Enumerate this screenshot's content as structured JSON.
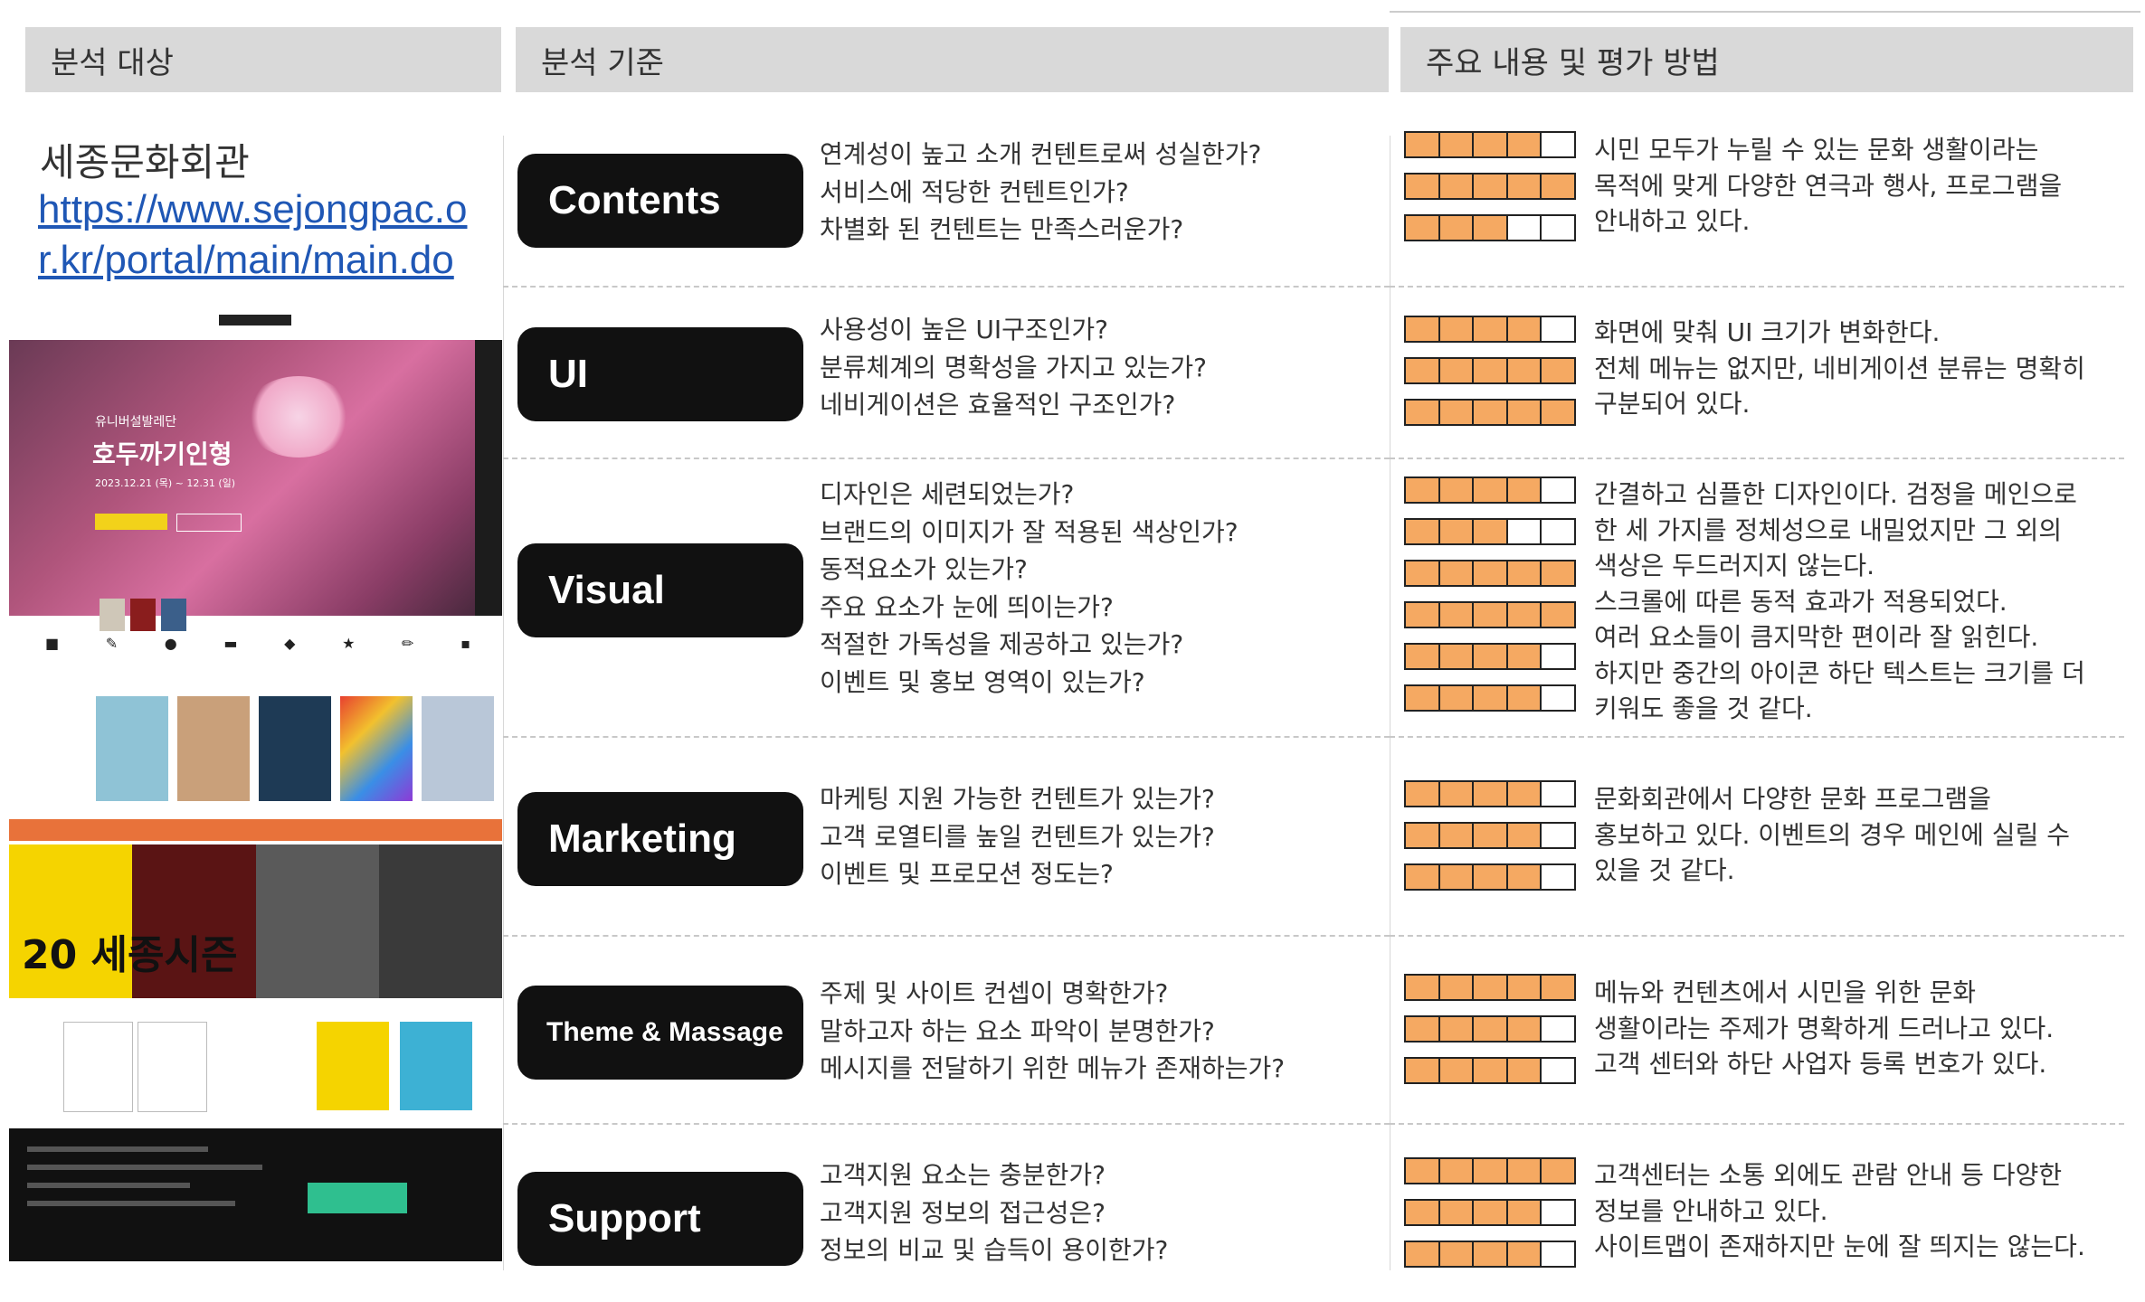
{
  "headers": {
    "target": "분석 대상",
    "criteria": "분석 기준",
    "evaluation": "주요 내용 및 평가 방법"
  },
  "target": {
    "name": "세종문화회관",
    "url": "https://www.sejongpac.or.kr/portal/main/main.do"
  },
  "screenshot": {
    "hero_subtitle": "유니버설발레단",
    "hero_title": "호두까기인형",
    "hero_dates": "2023.12.21 (목) ~ 12.31 (일)",
    "promo_text": "20 세종시즌",
    "icons": [
      "notice-icon",
      "edit-icon",
      "pin-icon",
      "ticket-icon",
      "map-icon",
      "star-icon",
      "pencil-icon",
      "bus-icon"
    ]
  },
  "sections": [
    {
      "label": "Contents",
      "questions": [
        "연계성이 높고 소개 컨텐트로써 성실한가?",
        "서비스에 적당한 컨텐트인가?",
        "차별화 된 컨텐트는 만족스러운가?"
      ],
      "ratings": [
        4,
        5,
        3
      ],
      "description": [
        "시민 모두가 누릴 수 있는 문화 생활이라는",
        "목적에 맞게 다양한 연극과 행사, 프로그램을",
        "안내하고 있다."
      ]
    },
    {
      "label": "UI",
      "questions": [
        "사용성이 높은 UI구조인가?",
        "분류체계의 명확성을 가지고 있는가?",
        "네비게이션은 효율적인 구조인가?"
      ],
      "ratings": [
        4,
        5,
        5
      ],
      "description": [
        "화면에 맞춰 UI 크기가 변화한다.",
        "전체 메뉴는 없지만, 네비게이션 분류는 명확히",
        "구분되어 있다."
      ]
    },
    {
      "label": "Visual",
      "questions": [
        "디자인은 세련되었는가?",
        "브랜드의 이미지가 잘 적용된 색상인가?",
        "동적요소가 있는가?",
        "주요 요소가 눈에 띄이는가?",
        "적절한 가독성을 제공하고 있는가?",
        "이벤트 및 홍보 영역이 있는가?"
      ],
      "ratings": [
        4,
        3,
        5,
        5,
        4,
        4
      ],
      "description": [
        "간결하고 심플한 디자인이다. 검정을 메인으로",
        "한 세 가지를 정체성으로 내밀었지만 그 외의",
        "색상은 두드러지지 않는다.",
        "스크롤에 따른 동적 효과가 적용되었다.",
        "여러 요소들이 큼지막한 편이라 잘 읽힌다.",
        "하지만 중간의 아이콘 하단 텍스트는 크기를 더",
        "키워도 좋을 것 같다."
      ]
    },
    {
      "label": "Marketing",
      "questions": [
        "마케팅 지원 가능한 컨텐트가 있는가?",
        "고객 로열티를 높일 컨텐트가 있는가?",
        "이벤트 및 프로모션 정도는?"
      ],
      "ratings": [
        4,
        4,
        4
      ],
      "description": [
        "문화회관에서 다양한 문화 프로그램을",
        "홍보하고 있다. 이벤트의 경우 메인에 실릴 수",
        "있을 것 같다."
      ]
    },
    {
      "label": "Theme & Massage",
      "questions": [
        "주제 및 사이트 컨셉이 명확한가?",
        "말하고자 하는 요소 파악이 분명한가?",
        "메시지를 전달하기 위한 메뉴가 존재하는가?"
      ],
      "ratings": [
        5,
        4,
        4
      ],
      "description": [
        "메뉴와 컨텐츠에서 시민을 위한 문화",
        "생활이라는 주제가 명확하게 드러나고 있다.",
        "고객 센터와 하단 사업자 등록 번호가 있다."
      ]
    },
    {
      "label": "Support",
      "questions": [
        "고객지원 요소는 충분한가?",
        "고객지원 정보의 접근성은?",
        "정보의 비교 및 습득이 용이한가?"
      ],
      "ratings": [
        5,
        4,
        4
      ],
      "description": [
        "고객센터는 소통 외에도 관람 안내 등 다양한",
        "정보를 안내하고 있다.",
        "사이트맵이 존재하지만 눈에 잘 띄지는 않는다."
      ]
    }
  ],
  "colors": {
    "rating_fill": "#f5a962",
    "badge": "#111111",
    "header_bg": "#d9d9d9",
    "link": "#1f57b5"
  }
}
